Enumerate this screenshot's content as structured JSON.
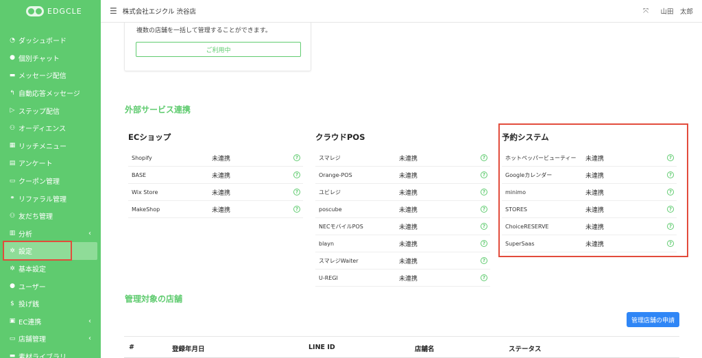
{
  "brand": {
    "name": "EDGCLE"
  },
  "header": {
    "store_name": "株式会社エジクル 渋谷店",
    "user_name": "山田　太郎"
  },
  "sidebar": {
    "items": [
      {
        "icon": "◔",
        "label": "ダッシュボード",
        "name": "dashboard"
      },
      {
        "icon": "●",
        "label": "個別チャット",
        "name": "chat"
      },
      {
        "icon": "▬",
        "label": "メッセージ配信",
        "name": "message"
      },
      {
        "icon": "↰",
        "label": "自動応答メッセージ",
        "name": "auto-reply"
      },
      {
        "icon": "▷",
        "label": "ステップ配信",
        "name": "step"
      },
      {
        "icon": "⚇",
        "label": "オーディエンス",
        "name": "audience"
      },
      {
        "icon": "▦",
        "label": "リッチメニュー",
        "name": "rich-menu"
      },
      {
        "icon": "▤",
        "label": "アンケート",
        "name": "survey"
      },
      {
        "icon": "▭",
        "label": "クーポン管理",
        "name": "coupon"
      },
      {
        "icon": "⚭",
        "label": "リファラル管理",
        "name": "referral"
      },
      {
        "icon": "⚇",
        "label": "友だち管理",
        "name": "friends"
      },
      {
        "icon": "▥",
        "label": "分析",
        "name": "analysis",
        "chevron": "‹"
      },
      {
        "icon": "✲",
        "label": "設定",
        "name": "settings",
        "active": true
      },
      {
        "icon": "✲",
        "label": "基本設定",
        "name": "basic-settings"
      },
      {
        "icon": "●",
        "label": "ユーザー",
        "name": "users"
      },
      {
        "icon": "$",
        "label": "投げ銭",
        "name": "tipping"
      },
      {
        "icon": "▣",
        "label": "EC連携",
        "name": "ec",
        "chevron": "‹"
      },
      {
        "icon": "▭",
        "label": "店舗管理",
        "name": "stores",
        "chevron": "‹"
      },
      {
        "icon": "▬",
        "label": "素材ライブラリ",
        "name": "library"
      }
    ]
  },
  "card": {
    "description": "複数の店舗を一括して管理することができます。",
    "button_label": "ご利用中"
  },
  "external": {
    "title": "外部サービス連携",
    "columns": [
      {
        "title": "ECショップ",
        "services": [
          {
            "name": "Shopify",
            "status": "未連携"
          },
          {
            "name": "BASE",
            "status": "未連携"
          },
          {
            "name": "Wix Store",
            "status": "未連携"
          },
          {
            "name": "MakeShop",
            "status": "未連携"
          }
        ]
      },
      {
        "title": "クラウドPOS",
        "services": [
          {
            "name": "スマレジ",
            "status": "未連携"
          },
          {
            "name": "Orange-POS",
            "status": "未連携"
          },
          {
            "name": "ユビレジ",
            "status": "未連携"
          },
          {
            "name": "poscube",
            "status": "未連携"
          },
          {
            "name": "NECモバイルPOS",
            "status": "未連携"
          },
          {
            "name": "blayn",
            "status": "未連携"
          },
          {
            "name": "スマレジWaiter",
            "status": "未連携"
          },
          {
            "name": "U-REGI",
            "status": "未連携"
          }
        ]
      },
      {
        "title": "予約システム",
        "services": [
          {
            "name": "ホットペッパービューティー",
            "status": "未連携"
          },
          {
            "name": "Googleカレンダー",
            "status": "未連携"
          },
          {
            "name": "minimo",
            "status": "未連携"
          },
          {
            "name": "STORES",
            "status": "未連携"
          },
          {
            "name": "ChoiceRESERVE",
            "status": "未連携"
          },
          {
            "name": "SuperSaas",
            "status": "未連携"
          }
        ]
      }
    ],
    "help_glyph": "?"
  },
  "managed": {
    "title": "管理対象の店舗",
    "apply_button": "管理店舗の申請",
    "columns": [
      "#",
      "登録年月日",
      "LINE ID",
      "店舗名",
      "ステータス"
    ]
  },
  "colors": {
    "accent": "#5fcb6f",
    "highlight": "#e24b3b",
    "primary_button": "#2f86f6"
  }
}
